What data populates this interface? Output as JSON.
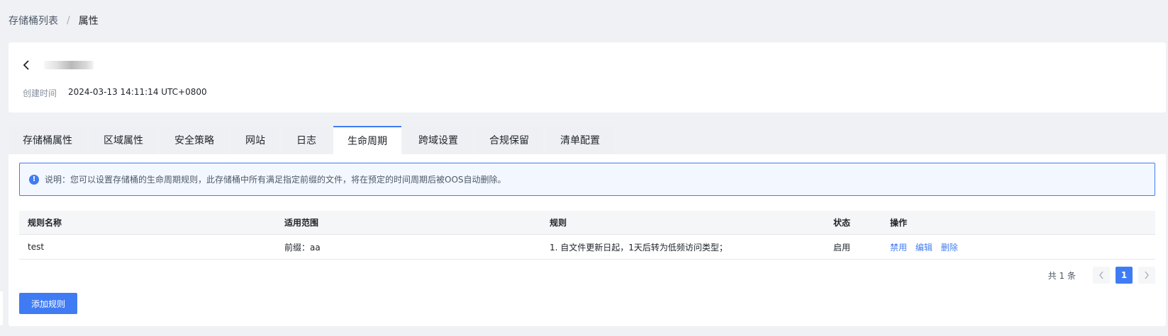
{
  "breadcrumb": {
    "parent": "存储桶列表",
    "separator": "/",
    "current": "属性"
  },
  "header": {
    "back_icon": "chevron-left-icon",
    "created_label": "创建时间",
    "created_value": "2024-03-13 14:11:14 UTC+0800"
  },
  "tabs": [
    {
      "label": "存储桶属性",
      "active": false
    },
    {
      "label": "区域属性",
      "active": false
    },
    {
      "label": "安全策略",
      "active": false
    },
    {
      "label": "网站",
      "active": false
    },
    {
      "label": "日志",
      "active": false
    },
    {
      "label": "生命周期",
      "active": true
    },
    {
      "label": "跨域设置",
      "active": false
    },
    {
      "label": "合规保留",
      "active": false
    },
    {
      "label": "清单配置",
      "active": false
    }
  ],
  "notice": {
    "icon": "info-icon",
    "text": "说明：您可以设置存储桶的生命周期规则，此存储桶中所有满足指定前缀的文件，将在预定的时间周期后被OOS自动删除。"
  },
  "table": {
    "columns": [
      "规则名称",
      "适用范围",
      "规则",
      "状态",
      "操作"
    ],
    "rows": [
      {
        "name": "test",
        "scope": "前缀：aa",
        "rule": "1. 自文件更新日起，1天后转为低频访问类型；",
        "status": "启用",
        "actions": [
          "禁用",
          "编辑",
          "删除"
        ]
      }
    ]
  },
  "pagination": {
    "total_text": "共 1 条",
    "prev_icon": "chevron-left-icon",
    "current_page": "1",
    "next_icon": "chevron-right-icon"
  },
  "add_rule_label": "添加规则",
  "colors": {
    "accent": "#3f7cf4",
    "background": "#f0f1f4"
  }
}
